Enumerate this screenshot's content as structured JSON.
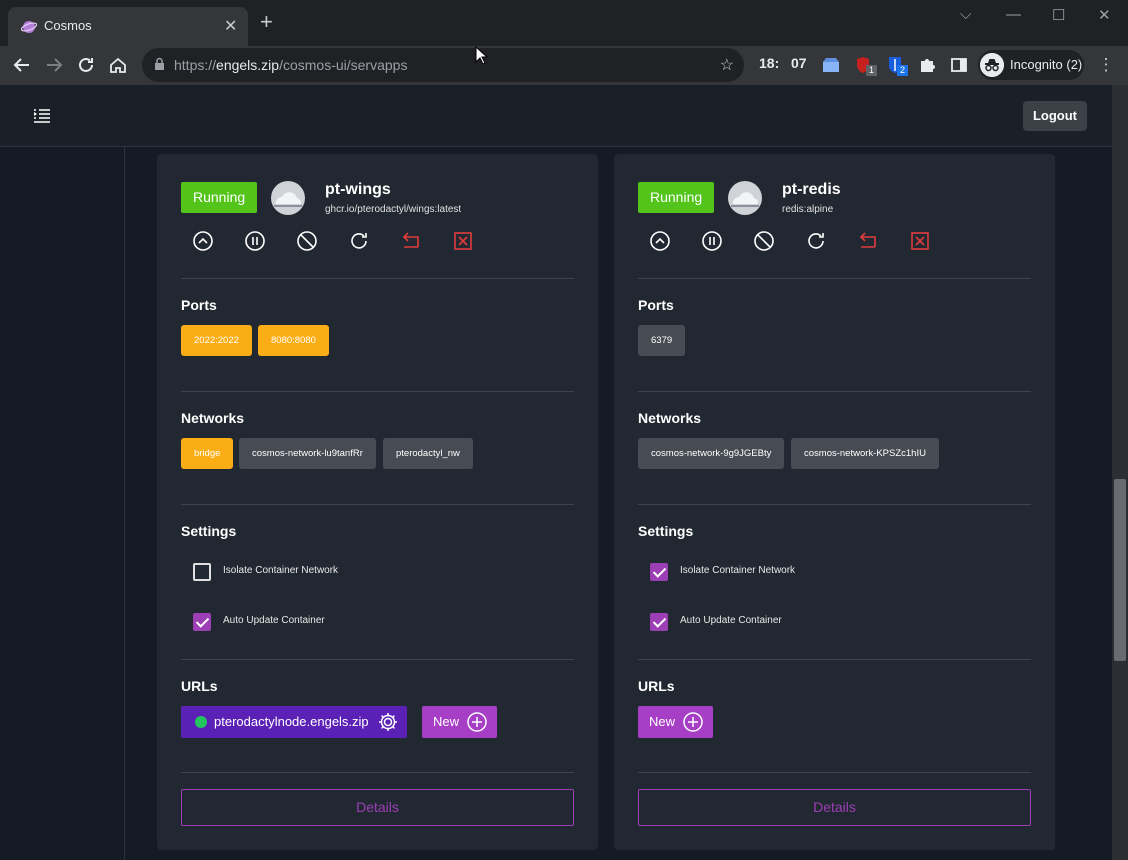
{
  "browser": {
    "tab_title": "Cosmos",
    "tab_close": "✕",
    "new_tab": "+",
    "window_controls": [
      "⌵",
      "—",
      "☐",
      "✕"
    ],
    "url_scheme": "https://",
    "url_host": "engels.zip",
    "url_path": "/cosmos-ui/servapps",
    "clock_hours": "18:",
    "clock_minutes": "07",
    "ext_badge_1": "1",
    "ext_badge_2": "2",
    "profile_label": "Incognito (2)"
  },
  "app": {
    "logout_label": "Logout"
  },
  "labels": {
    "ports": "Ports",
    "networks": "Networks",
    "settings": "Settings",
    "urls": "URLs",
    "isolate": "Isolate Container Network",
    "autoupdate": "Auto Update Container",
    "new": "New",
    "details": "Details"
  },
  "containers": [
    {
      "status": "Running",
      "name": "pt-wings",
      "image": "ghcr.io/pterodactyl/wings:latest",
      "ports": [
        "2022:2022",
        "8080:8080"
      ],
      "networks": [
        "bridge",
        "cosmos-network-lu9tanfRr",
        "pterodactyl_nw"
      ],
      "isolate_network": false,
      "auto_update": true,
      "urls": [
        "pterodactylnode.engels.zip"
      ]
    },
    {
      "status": "Running",
      "name": "pt-redis",
      "image": "redis:alpine",
      "ports": [
        "6379"
      ],
      "networks": [
        "cosmos-network-9g9JGEBty",
        "cosmos-network-KPSZc1hIU"
      ],
      "isolate_network": true,
      "auto_update": true,
      "urls": []
    }
  ],
  "colors": {
    "running": "#52c41a",
    "orange_chip": "#faad14",
    "grey_chip": "#474c54",
    "accent_purple": "#9c3fb5",
    "url_chip": "#5b21b6",
    "danger": "#e03c3c"
  }
}
